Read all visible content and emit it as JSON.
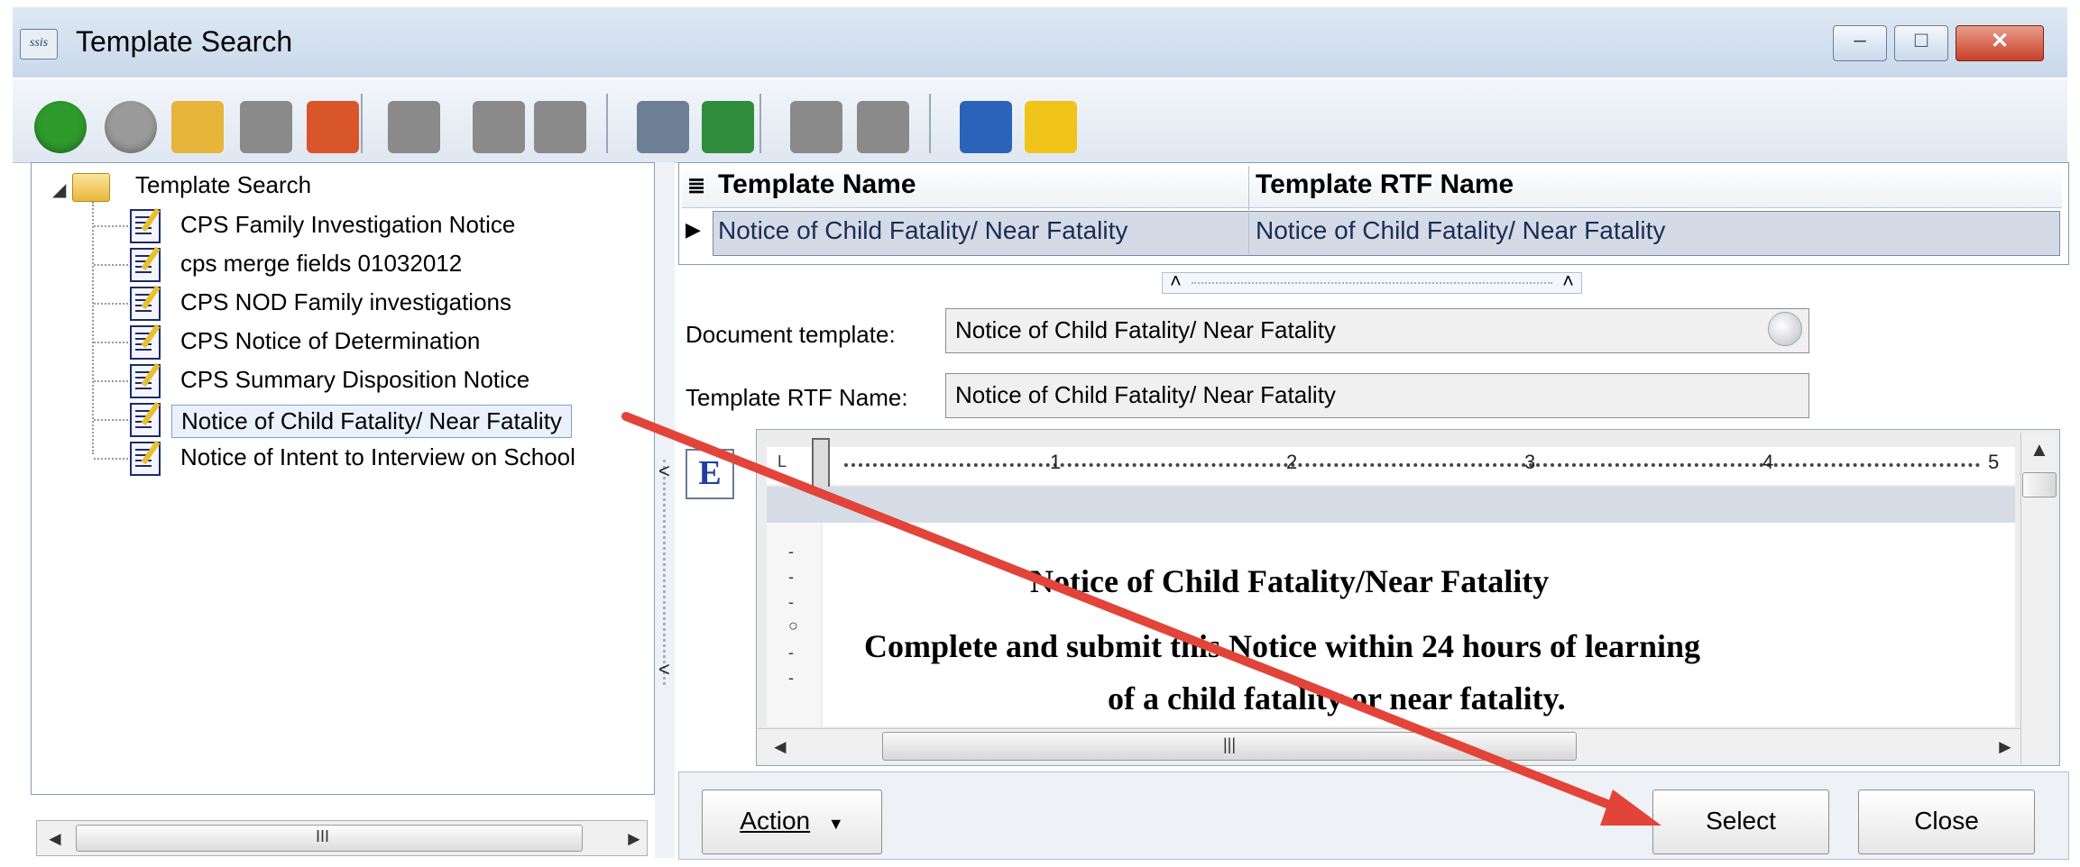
{
  "window": {
    "title": "Template Search",
    "app_icon_text": "ssis",
    "minimize_glyph": "–",
    "maximize_glyph": "□",
    "close_glyph": "✕"
  },
  "toolbar": {
    "buttons": [
      {
        "icon": "back-arrow-icon",
        "color": "#2e9a2b"
      },
      {
        "icon": "forward-arrow-icon",
        "color": "#9a9a9a"
      },
      {
        "icon": "open-folder-icon",
        "color": "#e7b53a"
      },
      {
        "icon": "bookmark-icon",
        "color": "#8a8a8a"
      },
      {
        "icon": "home-icon",
        "color": "#d9552a"
      },
      {
        "icon": "new-document-icon",
        "color": "#8a8a8a"
      },
      {
        "icon": "save-icon",
        "color": "#8a8a8a"
      },
      {
        "icon": "undo-icon",
        "color": "#8a8a8a"
      },
      {
        "icon": "print-icon",
        "color": "#6d7f95"
      },
      {
        "icon": "refresh-icon",
        "color": "#2d8d3b"
      },
      {
        "icon": "delete-icon",
        "color": "#8a8a8a"
      },
      {
        "icon": "clear-icon",
        "color": "#8a8a8a"
      },
      {
        "icon": "properties-icon",
        "color": "#2b63b8"
      },
      {
        "icon": "lightning-icon",
        "color": "#f0c419"
      }
    ]
  },
  "tree": {
    "root_label": "Template Search",
    "items": [
      {
        "label": "CPS Family Investigation Notice"
      },
      {
        "label": "cps merge fields 01032012"
      },
      {
        "label": "CPS NOD Family investigations"
      },
      {
        "label": "CPS Notice of Determination"
      },
      {
        "label": "CPS Summary Disposition Notice"
      },
      {
        "label": "Notice of Child Fatality/ Near Fatality",
        "selected": true
      },
      {
        "label": "Notice of Intent to Interview on School"
      }
    ],
    "scroll_left": "◄",
    "scroll_right": "►",
    "scroll_grip": "III"
  },
  "grid": {
    "columns": [
      "Template Name",
      "Template RTF Name"
    ],
    "rows": [
      [
        "Notice of Child Fatality/ Near Fatality",
        "Notice of Child Fatality/ Near Fatality"
      ]
    ],
    "header_icon": "≣",
    "row_pointer": "▶"
  },
  "form": {
    "document_template_label": "Document template:",
    "document_template_value": "Notice of Child Fatality/ Near Fatality",
    "rtf_name_label": "Template RTF Name:",
    "rtf_name_value": "Notice of Child Fatality/ Near Fatality"
  },
  "editor": {
    "style_button": "E",
    "ruler_corner": "L",
    "ruler_numbers": [
      "1",
      "2",
      "3",
      "4",
      "5"
    ],
    "doc_title": "Notice of Child Fatality/Near Fatality",
    "doc_line1": "Complete and submit this Notice within 24 hours of learning",
    "doc_line2": "of a child fatality or near fatality.",
    "vruler_marks": [
      "-",
      "-",
      "-",
      "○",
      "-",
      "-"
    ],
    "hscroll_grip": "|||"
  },
  "buttons": {
    "action": "Action",
    "action_arrow": "▼",
    "select": "Select",
    "close": "Close"
  },
  "colors": {
    "annotation_arrow": "#e2443a",
    "selection_border": "#7da2ce"
  }
}
